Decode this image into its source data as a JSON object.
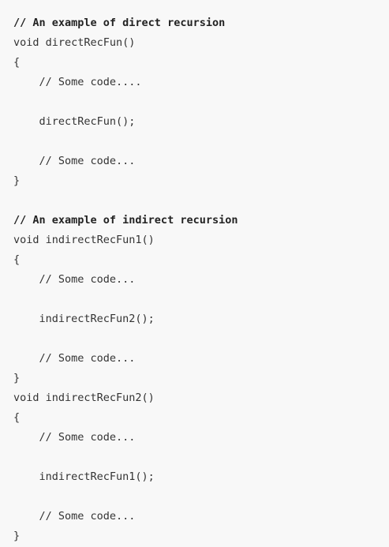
{
  "code": {
    "lines": [
      {
        "text": "// An example of direct recursion",
        "heading": true
      },
      {
        "text": "void directRecFun()",
        "heading": false
      },
      {
        "text": "{",
        "heading": false
      },
      {
        "text": "    // Some code....",
        "heading": false
      },
      {
        "text": "",
        "heading": false
      },
      {
        "text": "    directRecFun();",
        "heading": false
      },
      {
        "text": "",
        "heading": false
      },
      {
        "text": "    // Some code...",
        "heading": false
      },
      {
        "text": "}",
        "heading": false
      },
      {
        "text": "",
        "heading": false
      },
      {
        "text": "// An example of indirect recursion",
        "heading": true
      },
      {
        "text": "void indirectRecFun1()",
        "heading": false
      },
      {
        "text": "{",
        "heading": false
      },
      {
        "text": "    // Some code...",
        "heading": false
      },
      {
        "text": "",
        "heading": false
      },
      {
        "text": "    indirectRecFun2();",
        "heading": false
      },
      {
        "text": "",
        "heading": false
      },
      {
        "text": "    // Some code...",
        "heading": false
      },
      {
        "text": "}",
        "heading": false
      },
      {
        "text": "void indirectRecFun2()",
        "heading": false
      },
      {
        "text": "{",
        "heading": false
      },
      {
        "text": "    // Some code...",
        "heading": false
      },
      {
        "text": "",
        "heading": false
      },
      {
        "text": "    indirectRecFun1();",
        "heading": false
      },
      {
        "text": "",
        "heading": false
      },
      {
        "text": "    // Some code...",
        "heading": false
      },
      {
        "text": "}",
        "heading": false
      }
    ]
  }
}
